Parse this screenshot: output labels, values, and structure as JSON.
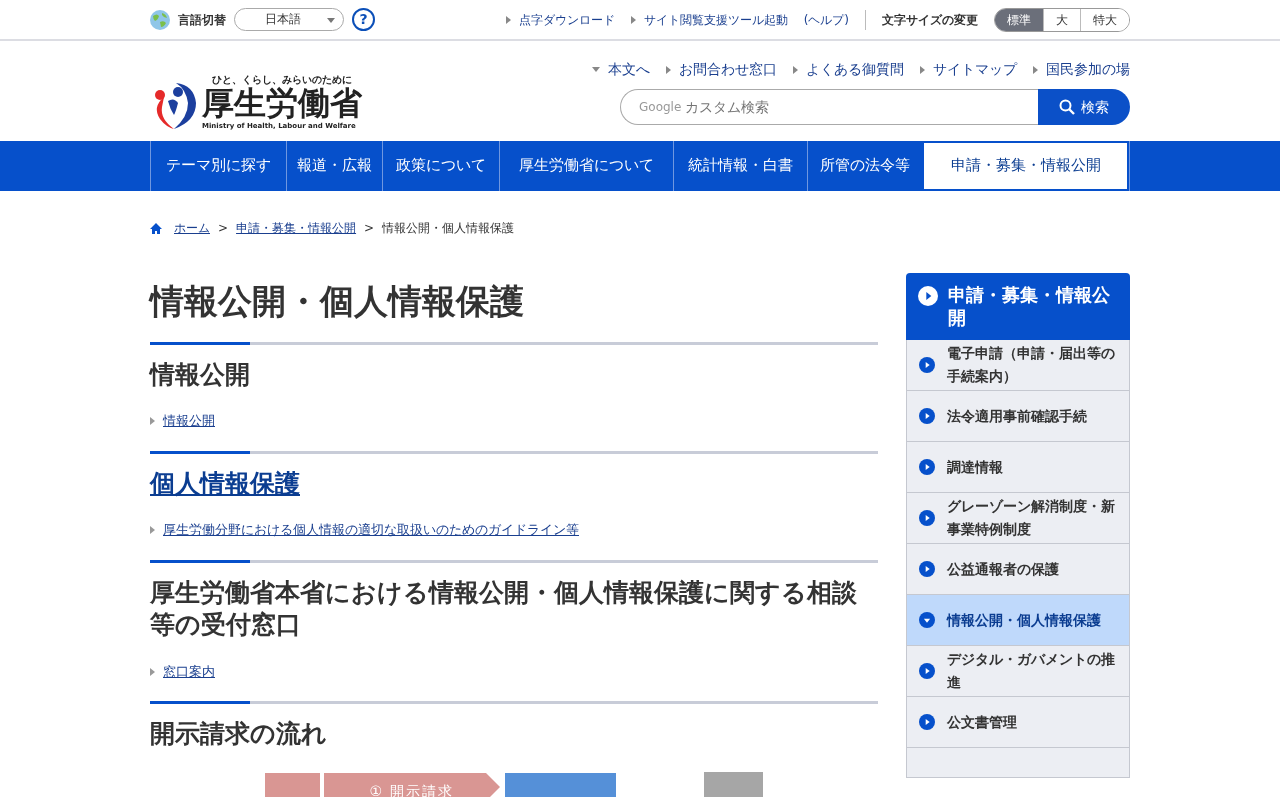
{
  "top_bar": {
    "language_label": "言語切替",
    "language_value": "日本語",
    "help": "?",
    "links": [
      "点字ダウンロード",
      "サイト閲覧支援ツール起動",
      "(ヘルプ)"
    ],
    "text_size_label": "文字サイズの変更",
    "text_sizes": [
      {
        "label": "標準",
        "selected": true
      },
      {
        "label": "大",
        "selected": false
      },
      {
        "label": "特大",
        "selected": false
      }
    ]
  },
  "header": {
    "tagline": "ひと、くらし、みらいのために",
    "logo_name": "厚生労働省",
    "logo_english": "Ministry of Health, Labour and Welfare",
    "links": [
      {
        "label": "本文へ",
        "kind": "down"
      },
      {
        "label": "お問合わせ窓口",
        "kind": "right"
      },
      {
        "label": "よくある御質問",
        "kind": "right"
      },
      {
        "label": "サイトマップ",
        "kind": "right"
      },
      {
        "label": "国民参加の場",
        "kind": "right"
      }
    ],
    "search_brand": "Google",
    "search_placeholder": "カスタム検索",
    "search_button": "検索"
  },
  "nav": [
    {
      "label": "テーマ別に探す",
      "selected": false
    },
    {
      "label": "報道・広報",
      "selected": false
    },
    {
      "label": "政策について",
      "selected": false
    },
    {
      "label": "厚生労働省について",
      "selected": false
    },
    {
      "label": "統計情報・白書",
      "selected": false
    },
    {
      "label": "所管の法令等",
      "selected": false
    },
    {
      "label": "申請・募集・情報公開",
      "selected": true
    }
  ],
  "breadcrumb_separator": ">",
  "breadcrumb": [
    {
      "label": "ホーム",
      "kind": "home"
    },
    {
      "label": "申請・募集・情報公開",
      "kind": "link"
    },
    {
      "label": "情報公開・個人情報保護",
      "kind": "current"
    }
  ],
  "page_title": "情報公開・個人情報保護",
  "sections": [
    {
      "heading": "情報公開",
      "heading_link": false,
      "links": [
        "情報公開"
      ]
    },
    {
      "heading": "個人情報保護",
      "heading_link": true,
      "links": [
        "厚生労働分野における個人情報の適切な取扱いのためのガイドライン等"
      ]
    },
    {
      "heading": "厚生労働省本省における情報公開・個人情報保護に関する相談等の受付窓口",
      "heading_link": false,
      "links": [
        "窓口案内"
      ]
    },
    {
      "heading": "開示請求の流れ",
      "heading_link": false
    }
  ],
  "flow_diagram": {
    "step_label": "① 開示請求"
  },
  "sidebar": {
    "title": "申請・募集・情報公開",
    "items": [
      {
        "label": "電子申請（申請・届出等の手続案内）",
        "selected": false
      },
      {
        "label": "法令適用事前確認手続",
        "selected": false
      },
      {
        "label": "調達情報",
        "selected": false
      },
      {
        "label": "グレーゾーン解消制度・新事業特例制度",
        "selected": false
      },
      {
        "label": "公益通報者の保護",
        "selected": false
      },
      {
        "label": "情報公開・個人情報保護",
        "selected": true
      },
      {
        "label": "デジタル・ガバメントの推進",
        "selected": false
      },
      {
        "label": "公文書管理",
        "selected": false
      }
    ]
  }
}
